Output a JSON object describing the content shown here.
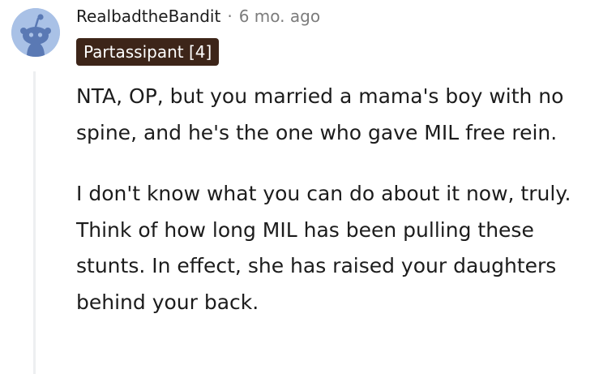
{
  "comment": {
    "author": "RealbadtheBandit",
    "separator": "·",
    "timestamp": "6 mo. ago",
    "flair": "Partassipant [4]",
    "paragraphs": [
      "NTA, OP, but you married a mama's boy with no spine, and he's the one who gave MIL free rein.",
      "I don't know what you can do about it now, truly. Think of how long MIL has been pulling these stunts. In effect, she has raised your daughters behind your back."
    ],
    "avatar": {
      "icon": "snoo-avatar-icon",
      "background": "#a9c1e6",
      "figure": "#5a79b4"
    }
  }
}
